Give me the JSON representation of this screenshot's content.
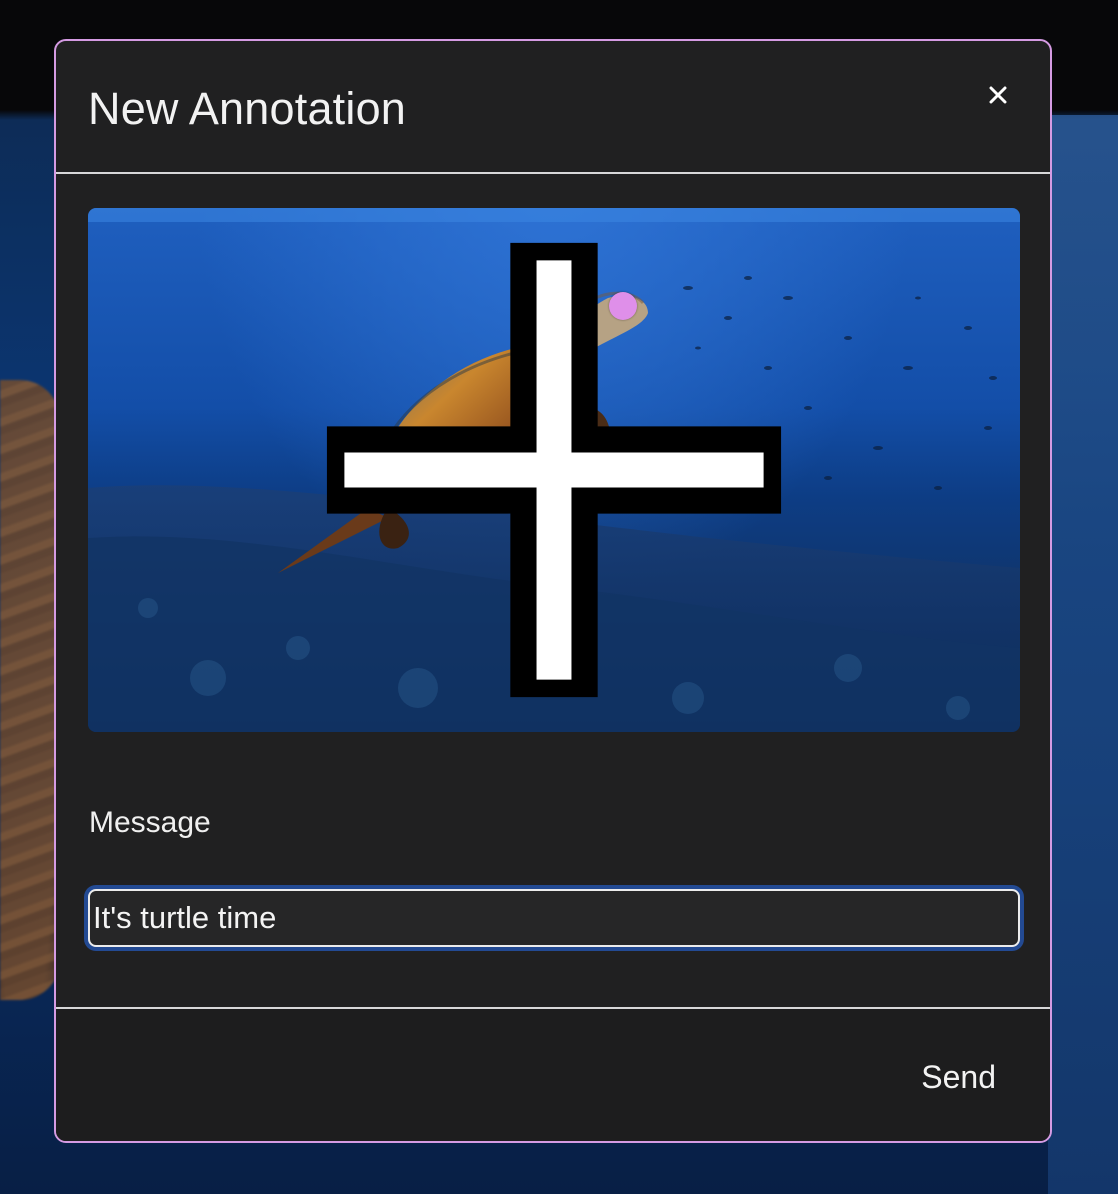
{
  "dialog": {
    "title": "New Annotation",
    "close_icon": "close-icon",
    "accent_color": "#d59be3"
  },
  "image": {
    "subject": "sea turtle swimming over coral reef",
    "annotation_marker_color": "#df8fe9",
    "cursor": "crosshair-icon"
  },
  "message": {
    "label": "Message",
    "value": "It's turtle time"
  },
  "footer": {
    "send_label": "Send"
  }
}
